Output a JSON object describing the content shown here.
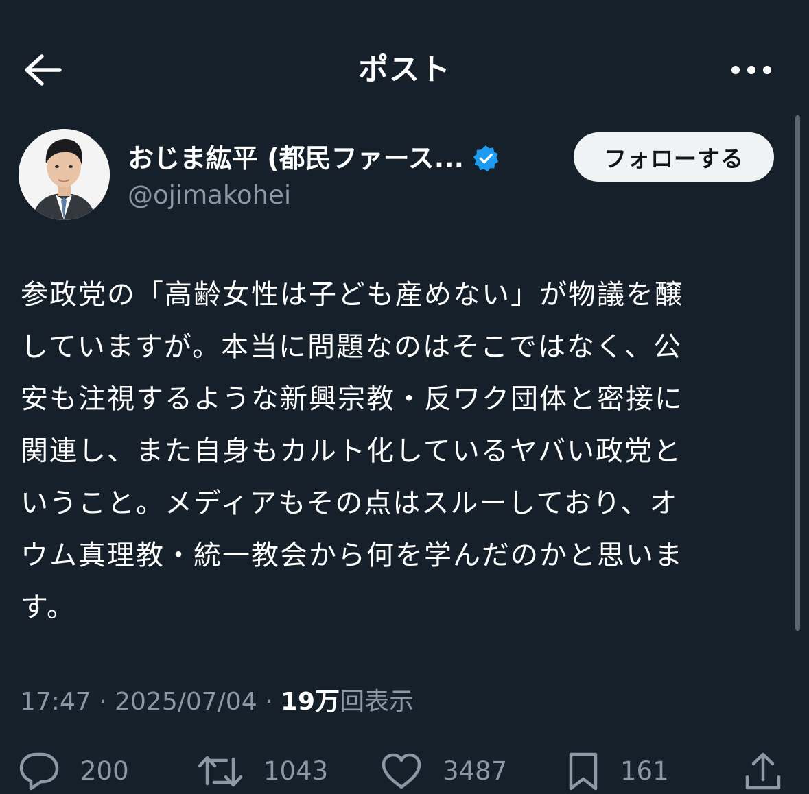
{
  "header": {
    "title": "ポスト",
    "back_icon": "arrow-left-icon",
    "more_icon": "more-dots-icon"
  },
  "author": {
    "display_name": "おじま紘平 (都民ファース...",
    "handle": "@ojimakohei",
    "verified_icon": "verified-badge-icon",
    "follow_label": "フォローする"
  },
  "tweet": {
    "text": "参政党の「高齢女性は子ども産めない」が物議を醸\nしていますが。本当に問題なのはそこではなく、公\n安も注視するような新興宗教・反ワク団体と密接に\n関連し、また自身もカルト化しているヤバい政党と\nいうこと。メディアもその点はスルーしており、オ\nウム真理教・統一教会から何を学んだのかと思いま\nす。"
  },
  "meta": {
    "time": "17:47",
    "separator": "·",
    "date": "2025/07/04",
    "views_count": "19万",
    "views_label": "回表示"
  },
  "actions": {
    "replies": "200",
    "reposts": "1043",
    "likes": "3487",
    "bookmarks": "161"
  },
  "colors": {
    "background": "#15202b",
    "muted": "#8b98a5",
    "verified": "#1d9bf0"
  }
}
